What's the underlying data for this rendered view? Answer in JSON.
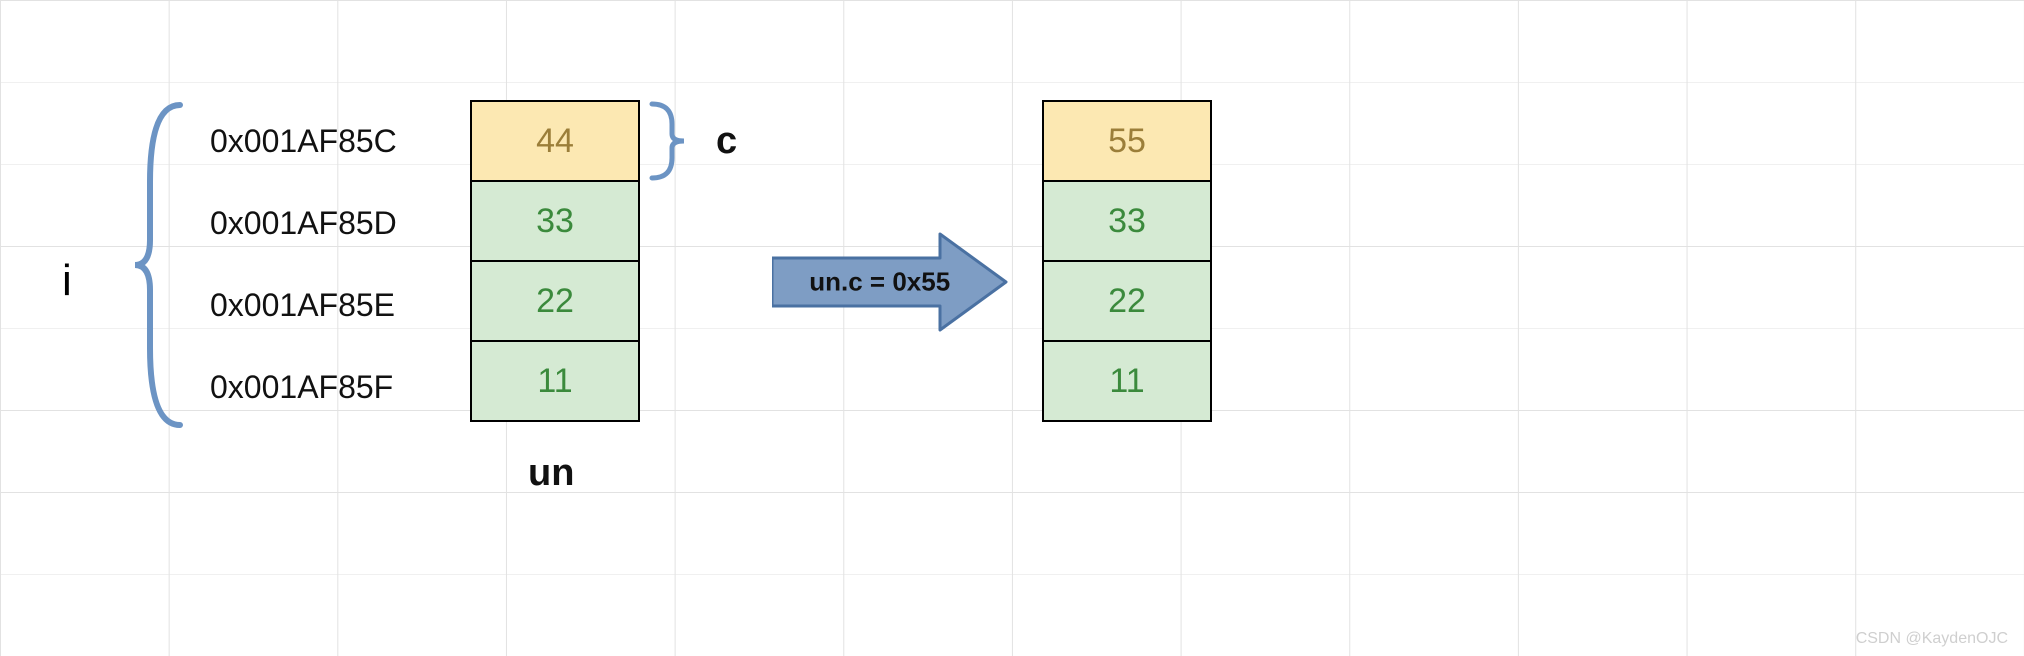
{
  "labels": {
    "i": "i",
    "c": "c",
    "un": "un",
    "assignment": "un.c = 0x55"
  },
  "addresses": [
    "0x001AF85C",
    "0x001AF85D",
    "0x001AF85E",
    "0x001AF85F"
  ],
  "before": {
    "b0": "44",
    "b1": "33",
    "b2": "22",
    "b3": "11"
  },
  "after": {
    "b0": "55",
    "b1": "33",
    "b2": "22",
    "b3": "11"
  },
  "colors": {
    "brace": "#6c94c4",
    "arrowFill": "#7e9dc4",
    "arrowStroke": "#4a71a2",
    "yellow": "#fce8b2",
    "green": "#d5ead3"
  },
  "watermark": "CSDN @KaydenOJC"
}
